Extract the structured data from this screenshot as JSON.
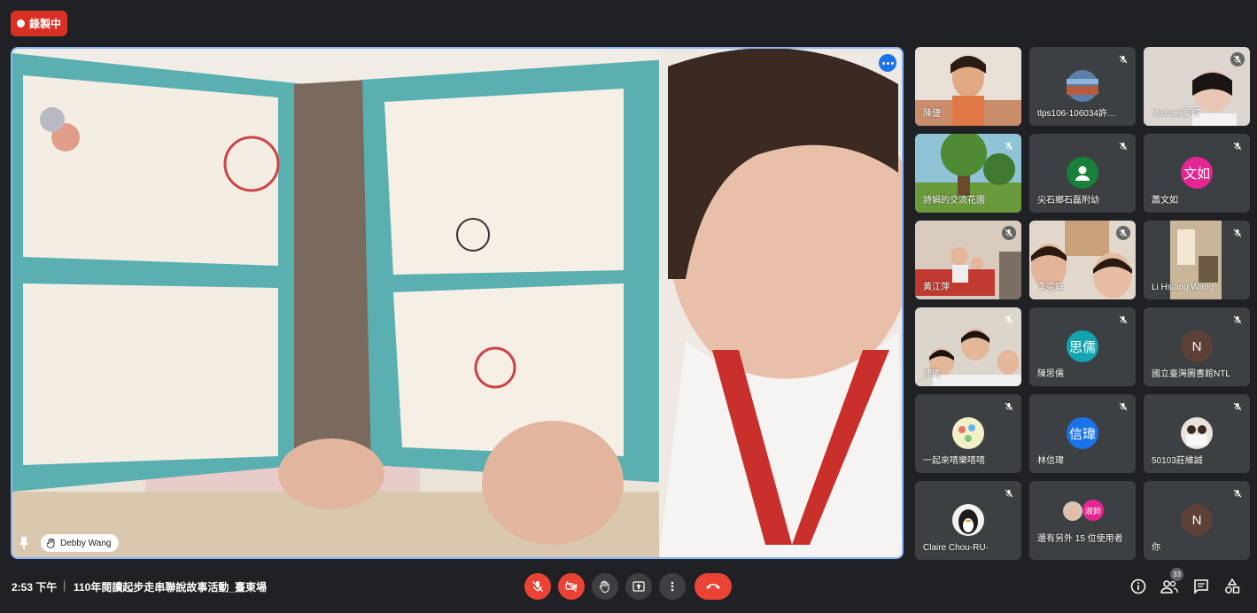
{
  "recording": {
    "label": "錄製中"
  },
  "main_video": {
    "presenter_name": "Debby Wang"
  },
  "participants": [
    {
      "name": "陳倢",
      "type": "video",
      "muted": false
    },
    {
      "name": "tlps106-106034許…",
      "type": "image",
      "muted": true
    },
    {
      "name": "Michael麥可",
      "type": "video",
      "muted": true
    },
    {
      "name": "詩娟的交流花園",
      "type": "image",
      "muted": true
    },
    {
      "name": "尖石鄉石磊附幼",
      "type": "avatar",
      "muted": true,
      "avatar_color": "#188038"
    },
    {
      "name": "蕭文如",
      "type": "avatar",
      "muted": true,
      "avatar_text": "文如",
      "avatar_color": "#e52592"
    },
    {
      "name": "黃江萍",
      "type": "video",
      "muted": true
    },
    {
      "name": "李奕錞",
      "type": "video",
      "muted": true
    },
    {
      "name": "Li Hsiang Wang",
      "type": "video",
      "muted": true
    },
    {
      "name": "沛晞",
      "type": "video",
      "muted": true
    },
    {
      "name": "陳思儒",
      "type": "avatar",
      "muted": true,
      "avatar_text": "思儒",
      "avatar_color": "#12a4af"
    },
    {
      "name": "國立臺灣圖書館NTL",
      "type": "avatar",
      "muted": true,
      "avatar_text": "N",
      "avatar_color": "#5d4037"
    },
    {
      "name": "一起來嘻樂嘻嘻",
      "type": "image",
      "muted": true
    },
    {
      "name": "林信瑋",
      "type": "avatar",
      "muted": true,
      "avatar_text": "信瑋",
      "avatar_color": "#1a73e8"
    },
    {
      "name": "50103莊維誠",
      "type": "image",
      "muted": true
    },
    {
      "name": "Claire Chou-RU-",
      "type": "image",
      "muted": true
    },
    {
      "name": "還有另外 15 位使用者",
      "type": "others",
      "muted": false,
      "avatar_text": "淑鈴"
    },
    {
      "name": "你",
      "type": "avatar",
      "muted": true,
      "avatar_text": "N",
      "avatar_color": "#5d4037"
    }
  ],
  "meeting": {
    "time": "2:53 下午",
    "separator": "|",
    "title": "110年閱讀起步走串聯說故事活動_臺東場"
  },
  "controls": [
    "mic-off",
    "camera-off",
    "raise-hand",
    "present-screen",
    "more-options",
    "leave-call"
  ],
  "right_controls": {
    "info": "info-icon",
    "people": "people-icon",
    "participant_count": "33",
    "chat": "chat-icon",
    "activities": "activities-icon"
  },
  "colors": {
    "background": "#202124",
    "tile": "#3c4043",
    "accent": "#8ab4f8",
    "danger": "#ea4335"
  }
}
